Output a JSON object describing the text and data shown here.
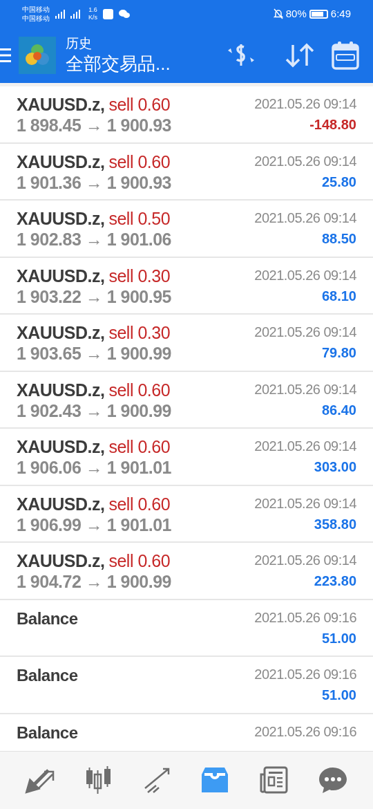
{
  "status_bar": {
    "carriers": [
      "中国移动",
      "中国移动"
    ],
    "net_speed": [
      "1.6",
      "K/s"
    ],
    "battery": "80%",
    "time": "6:49"
  },
  "header": {
    "title": "历史",
    "subtitle": "全部交易品..."
  },
  "deals": [
    {
      "kind": "trade",
      "symbol": "XAUUSD.z,",
      "side": "sell 0.60",
      "prices": "1 898.45 → 1 900.93",
      "time": "2021.05.26 09:14",
      "profit": "-148.80",
      "loss": true
    },
    {
      "kind": "trade",
      "symbol": "XAUUSD.z,",
      "side": "sell 0.60",
      "prices": "1 901.36 → 1 900.93",
      "time": "2021.05.26 09:14",
      "profit": "25.80",
      "loss": false
    },
    {
      "kind": "trade",
      "symbol": "XAUUSD.z,",
      "side": "sell 0.50",
      "prices": "1 902.83 → 1 901.06",
      "time": "2021.05.26 09:14",
      "profit": "88.50",
      "loss": false
    },
    {
      "kind": "trade",
      "symbol": "XAUUSD.z,",
      "side": "sell 0.30",
      "prices": "1 903.22 → 1 900.95",
      "time": "2021.05.26 09:14",
      "profit": "68.10",
      "loss": false
    },
    {
      "kind": "trade",
      "symbol": "XAUUSD.z,",
      "side": "sell 0.30",
      "prices": "1 903.65 → 1 900.99",
      "time": "2021.05.26 09:14",
      "profit": "79.80",
      "loss": false
    },
    {
      "kind": "trade",
      "symbol": "XAUUSD.z,",
      "side": "sell 0.60",
      "prices": "1 902.43 → 1 900.99",
      "time": "2021.05.26 09:14",
      "profit": "86.40",
      "loss": false
    },
    {
      "kind": "trade",
      "symbol": "XAUUSD.z,",
      "side": "sell 0.60",
      "prices": "1 906.06 → 1 901.01",
      "time": "2021.05.26 09:14",
      "profit": "303.00",
      "loss": false
    },
    {
      "kind": "trade",
      "symbol": "XAUUSD.z,",
      "side": "sell 0.60",
      "prices": "1 906.99 → 1 901.01",
      "time": "2021.05.26 09:14",
      "profit": "358.80",
      "loss": false
    },
    {
      "kind": "trade",
      "symbol": "XAUUSD.z,",
      "side": "sell 0.60",
      "prices": "1 904.72 → 1 900.99",
      "time": "2021.05.26 09:14",
      "profit": "223.80",
      "loss": false
    },
    {
      "kind": "balance",
      "symbol": "Balance",
      "time": "2021.05.26 09:16",
      "profit": "51.00",
      "loss": false
    },
    {
      "kind": "balance",
      "symbol": "Balance",
      "time": "2021.05.26 09:16",
      "profit": "51.00",
      "loss": false
    },
    {
      "kind": "balance",
      "symbol": "Balance",
      "time": "2021.05.26 09:16"
    }
  ],
  "bottom_nav": [
    {
      "selected": false
    },
    {
      "selected": false
    },
    {
      "selected": false
    },
    {
      "selected": true
    },
    {
      "selected": false
    },
    {
      "selected": false
    }
  ]
}
